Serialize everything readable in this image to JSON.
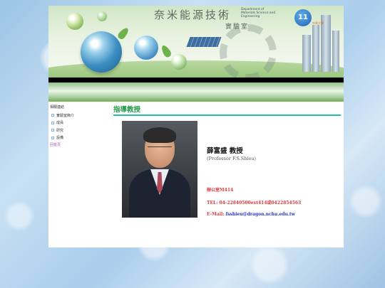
{
  "banner": {
    "title": "奈米能源技術",
    "subtitle": "實驗室",
    "dept_lines": [
      "Department of",
      "Materials Science and",
      "Engineering"
    ],
    "logo_text": "中興大學"
  },
  "nav": {
    "items": [
      "",
      "",
      "",
      "",
      "",
      ""
    ]
  },
  "sidebar": {
    "title": "相關連結",
    "items": [
      "實驗室簡介",
      "成員",
      "研究",
      "設備"
    ],
    "back": "回首頁"
  },
  "main": {
    "heading": "指導教授",
    "name": "薛富盛 教授",
    "name_en": "(Professor F.S.Shieu)",
    "office": "辦公室M414",
    "tel": "TEL: 04-22840500ext414或0422854563",
    "email_label": "E-Mail:",
    "email": "fsshieu@dragon.nchu.edu.tw"
  },
  "colors": {
    "heading": "#239a4a",
    "heading_line": "#21c49a",
    "contact": "#e23b3b",
    "link": "#2435c8"
  }
}
